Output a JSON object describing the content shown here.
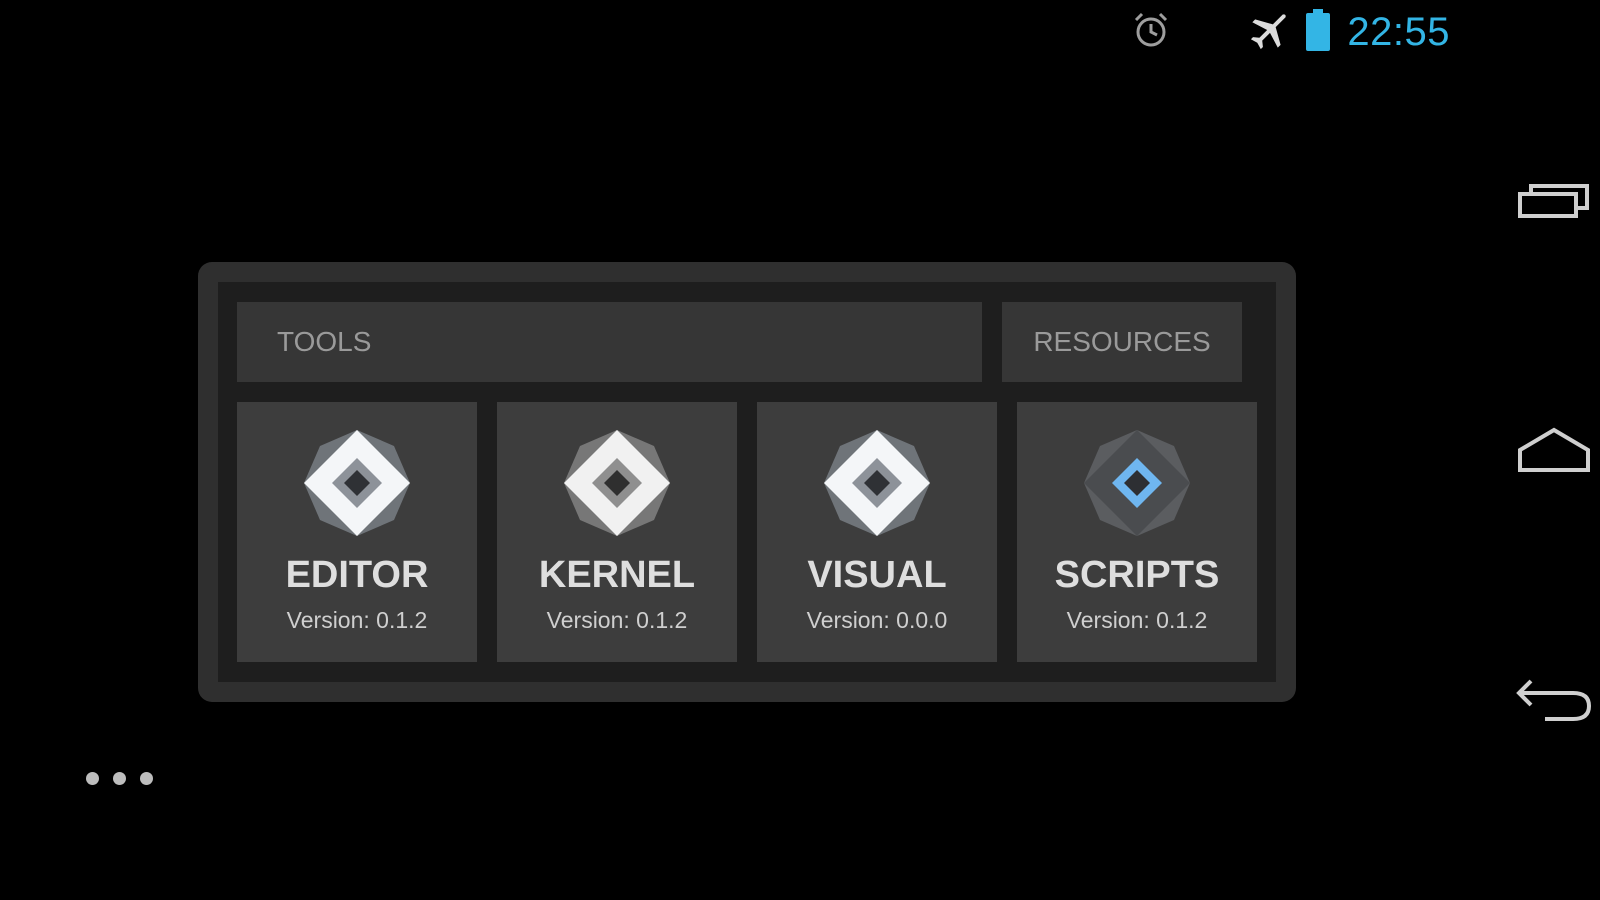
{
  "status_bar": {
    "time": "22:55",
    "icons": [
      "alarm-icon",
      "airplane-mode-icon",
      "battery-icon"
    ],
    "accent_color": "#33b5e5"
  },
  "widget": {
    "header": {
      "tools_label": "TOOLS",
      "resources_label": "RESOURCES"
    },
    "tiles": [
      {
        "name": "EDITOR",
        "version": "Version: 0.1.2",
        "icon": "diamond-logo-icon"
      },
      {
        "name": "KERNEL",
        "version": "Version: 0.1.2",
        "icon": "diamond-logo-icon"
      },
      {
        "name": "VISUAL",
        "version": "Version: 0.0.0",
        "icon": "diamond-logo-icon"
      },
      {
        "name": "SCRIPTS",
        "version": "Version: 0.1.2",
        "icon": "diamond-logo-blue-icon"
      }
    ]
  },
  "nav_bar": {
    "buttons": [
      "recent-apps-icon",
      "home-icon",
      "back-icon"
    ]
  },
  "colors": {
    "background": "#000000",
    "widget_frame": "#2f2f2f",
    "tile": "#3d3d3d",
    "header_text": "#9a9a9a",
    "scripts_accent": "#6fb6f0"
  }
}
